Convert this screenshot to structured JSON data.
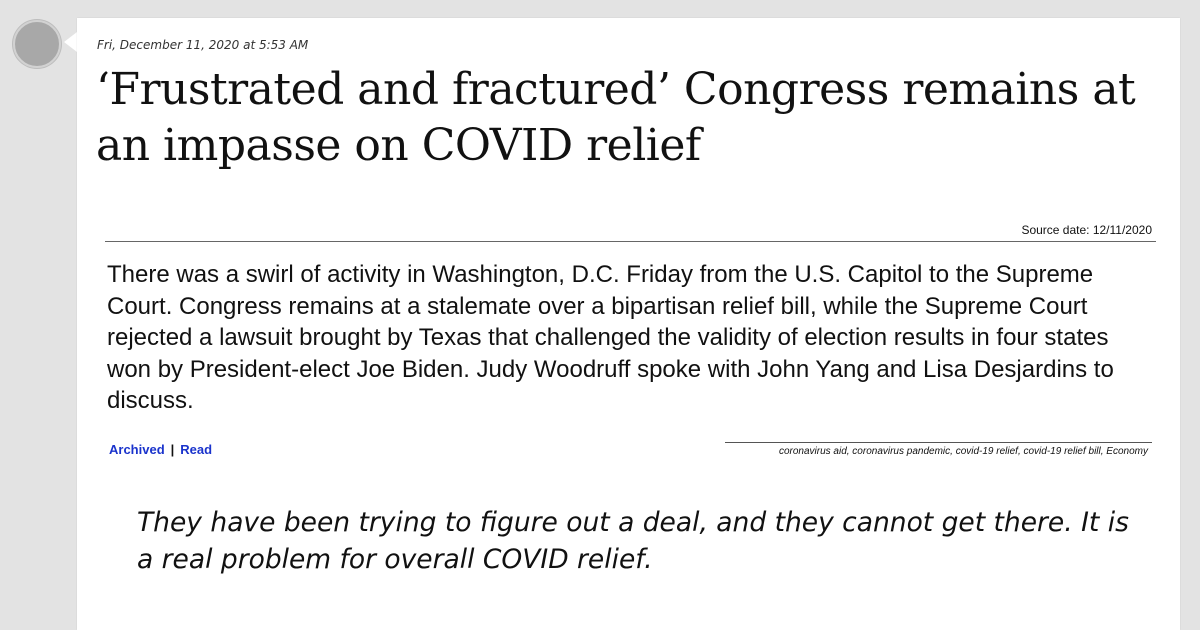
{
  "post": {
    "timestamp": "Fri, December 11, 2020 at 5:53 AM",
    "headline": "‘Frustrated and fractured’ Congress remains at an impasse on COVID relief",
    "source_date": "Source date: 12/11/2020",
    "summary": "There was a swirl of activity in Washington, D.C. Friday from the U.S. Capitol to the Supreme Court. Congress remains at a stalemate over a bipartisan relief bill, while the Supreme Court rejected a lawsuit brought by Texas that challenged the validity of election results in four states won by President-elect Joe Biden. Judy Woodruff spoke with John Yang and Lisa Desjardins to discuss.",
    "links": {
      "archived": "Archived",
      "separator": "|",
      "read": "Read"
    },
    "tags": "coronavirus aid, coronavirus pandemic, covid-19 relief, covid-19 relief bill, Economy",
    "quote": "They have been trying to figure out a deal, and they cannot get there. It is a real problem for overall COVID relief."
  },
  "colors": {
    "background": "#e3e3e3",
    "card": "#ffffff",
    "link": "#1a33cc",
    "avatar": "#a8a8a8"
  }
}
